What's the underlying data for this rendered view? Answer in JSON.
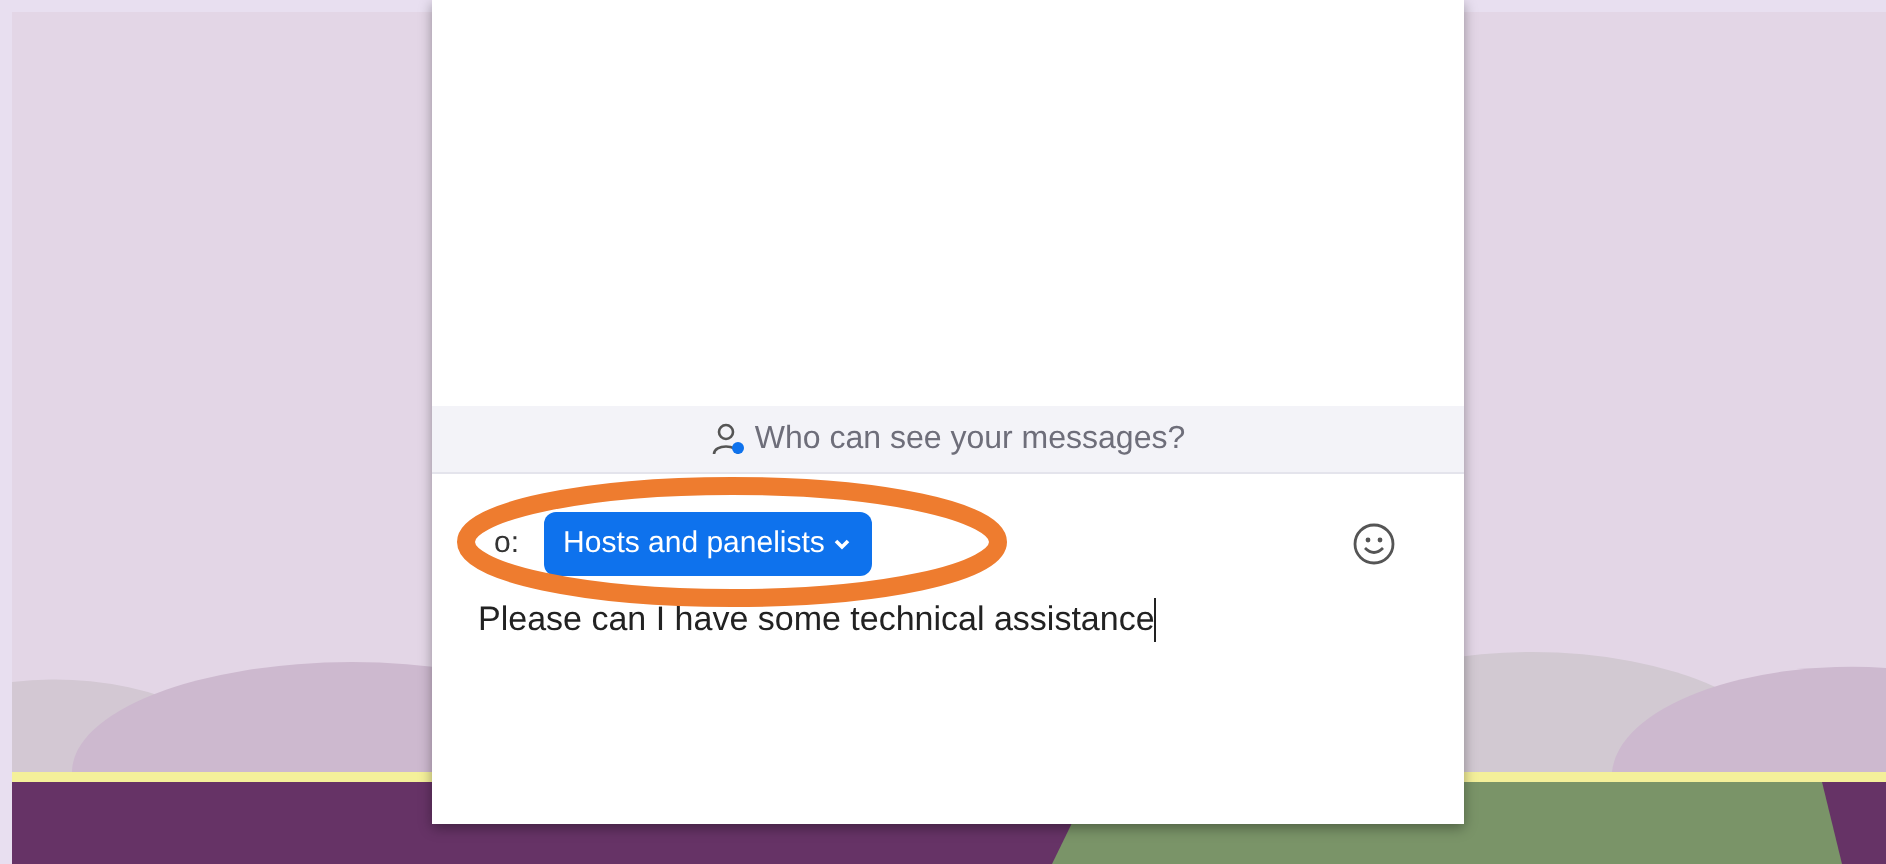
{
  "chat_panel": {
    "visibility_notice": "Who can see your messages?",
    "recipient_label": "o:",
    "recipient": "Hosts and panelists",
    "message": "Please can I have some technical assistance"
  }
}
